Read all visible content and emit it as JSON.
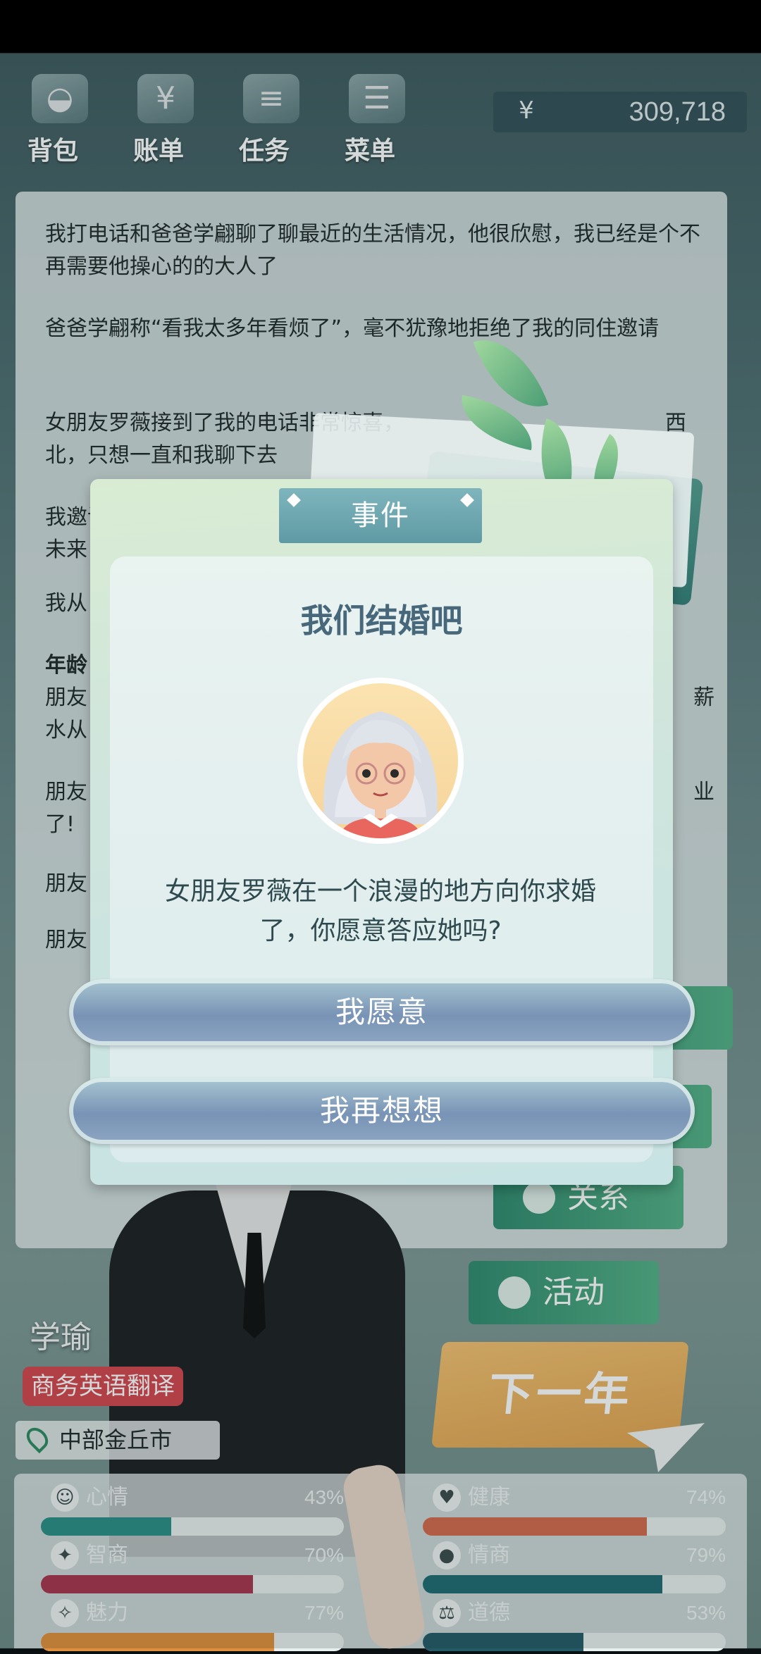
{
  "nav": {
    "items": [
      {
        "label": "背包",
        "icon": "bag-icon"
      },
      {
        "label": "账单",
        "icon": "bill-icon"
      },
      {
        "label": "任务",
        "icon": "task-icon"
      },
      {
        "label": "菜单",
        "icon": "menu-icon"
      }
    ],
    "money_symbol": "¥",
    "money": "309,718"
  },
  "log": {
    "p1": "我打电话和爸爸学翩聊了聊最近的生活情况，他很欣慰，我已经是个不再需要他操心的的大人了",
    "p2": "爸爸学翩称“看我太多年看烦了”，毫不犹豫地拒绝了我的同住邀请",
    "p3a": "女朋友罗薇接到了我的电话非常惊喜，",
    "p3b": "西",
    "p3c": "北，只想一直和我聊下去",
    "p4a": "我邀请",
    "p4b": "未来",
    "p5": "我从",
    "p6": "年龄",
    "p7a": "朋友",
    "p7b": "薪",
    "p7c": "水从",
    "p8a": "朋友",
    "p8b": "业",
    "p8c": "了!",
    "p9": "朋友",
    "p10": "朋友"
  },
  "side": {
    "relation_label": "关系",
    "activity_label": "活动"
  },
  "character": {
    "name": "学瑜",
    "job": "商务英语翻译",
    "city": "中部金丘市"
  },
  "next_year_label": "下一年",
  "stats": [
    {
      "label": "心情",
      "value": "43%",
      "level": 0.43,
      "color": "#2a8f86",
      "icon": "smile-icon",
      "glyph": "☺"
    },
    {
      "label": "健康",
      "value": "74%",
      "level": 0.74,
      "color": "#d36a4c",
      "icon": "heart-icon",
      "glyph": "♥"
    },
    {
      "label": "智商",
      "value": "70%",
      "level": 0.7,
      "color": "#a8344e",
      "icon": "bulb-icon",
      "glyph": "✦"
    },
    {
      "label": "情商",
      "value": "79%",
      "level": 0.79,
      "color": "#1f6b73",
      "icon": "apple-icon",
      "glyph": "●"
    },
    {
      "label": "魅力",
      "value": "77%",
      "level": 0.77,
      "color": "#e08f3c",
      "icon": "sparkle-icon",
      "glyph": "✧"
    },
    {
      "label": "道德",
      "value": "53%",
      "level": 0.53,
      "color": "#245a66",
      "icon": "scale-icon",
      "glyph": "⚖"
    }
  ],
  "dialog": {
    "tab": "事件",
    "title": "我们结婚吧",
    "message_line1": "女朋友罗薇在一个浪漫的地方向你求婚",
    "message_line2": "了，你愿意答应她吗?",
    "accept": "我愿意",
    "decline": "我再想想"
  }
}
